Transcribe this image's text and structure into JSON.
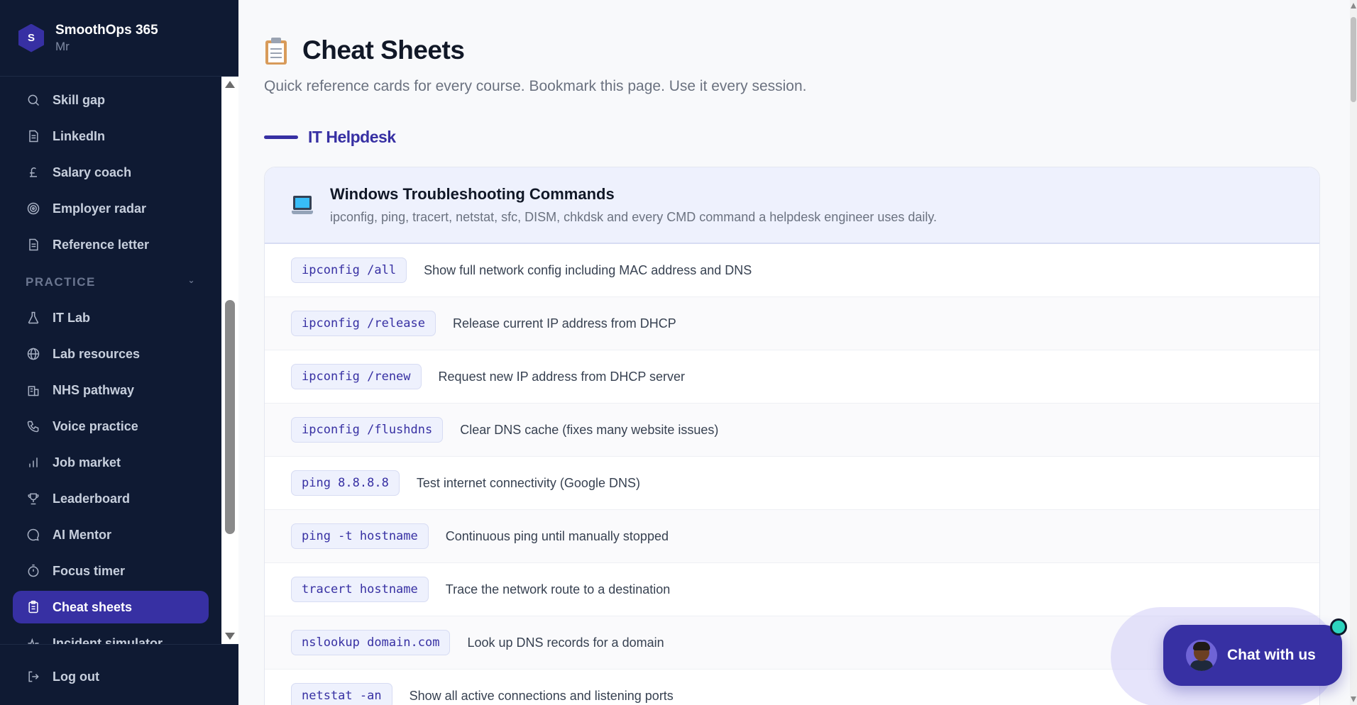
{
  "brand": {
    "initial": "S",
    "name": "SmoothOps 365",
    "subtitle": "Mr"
  },
  "sidebar": {
    "items": [
      {
        "label": "Skill gap",
        "icon": "search-icon"
      },
      {
        "label": "LinkedIn",
        "icon": "document-icon"
      },
      {
        "label": "Salary coach",
        "icon": "pound-icon"
      },
      {
        "label": "Employer radar",
        "icon": "radar-icon"
      },
      {
        "label": "Reference letter",
        "icon": "document-icon"
      }
    ],
    "section_label": "PRACTICE",
    "practice_items": [
      {
        "label": "IT Lab",
        "icon": "flask-icon"
      },
      {
        "label": "Lab resources",
        "icon": "globe-icon"
      },
      {
        "label": "NHS pathway",
        "icon": "building-icon"
      },
      {
        "label": "Voice practice",
        "icon": "phone-icon"
      },
      {
        "label": "Job market",
        "icon": "bar-chart-icon"
      },
      {
        "label": "Leaderboard",
        "icon": "trophy-icon"
      },
      {
        "label": "AI Mentor",
        "icon": "chat-bubble-icon"
      },
      {
        "label": "Focus timer",
        "icon": "timer-icon"
      },
      {
        "label": "Cheat sheets",
        "icon": "clipboard-icon",
        "active": true
      },
      {
        "label": "Incident simulator",
        "icon": "pulse-icon"
      }
    ],
    "logout_label": "Log out"
  },
  "page": {
    "title": "Cheat Sheets",
    "subtitle": "Quick reference cards for every course. Bookmark this page. Use it every session."
  },
  "section": {
    "title": "IT Helpdesk"
  },
  "card": {
    "title": "Windows Troubleshooting Commands",
    "description": "ipconfig, ping, tracert, netstat, sfc, DISM, chkdsk and every CMD command a helpdesk engineer uses daily.",
    "rows": [
      {
        "cmd": "ipconfig /all",
        "desc": "Show full network config including MAC address and DNS"
      },
      {
        "cmd": "ipconfig /release",
        "desc": "Release current IP address from DHCP"
      },
      {
        "cmd": "ipconfig /renew",
        "desc": "Request new IP address from DHCP server"
      },
      {
        "cmd": "ipconfig /flushdns",
        "desc": "Clear DNS cache (fixes many website issues)"
      },
      {
        "cmd": "ping 8.8.8.8",
        "desc": "Test internet connectivity (Google DNS)"
      },
      {
        "cmd": "ping -t hostname",
        "desc": "Continuous ping until manually stopped"
      },
      {
        "cmd": "tracert hostname",
        "desc": "Trace the network route to a destination"
      },
      {
        "cmd": "nslookup domain.com",
        "desc": "Look up DNS records for a domain"
      },
      {
        "cmd": "netstat -an",
        "desc": "Show all active connections and listening ports"
      }
    ]
  },
  "chat": {
    "label": "Chat with us"
  },
  "colors": {
    "sidebar_bg": "#0f1a33",
    "accent": "#3730a3",
    "card_head_bg": "#eef1fd"
  }
}
